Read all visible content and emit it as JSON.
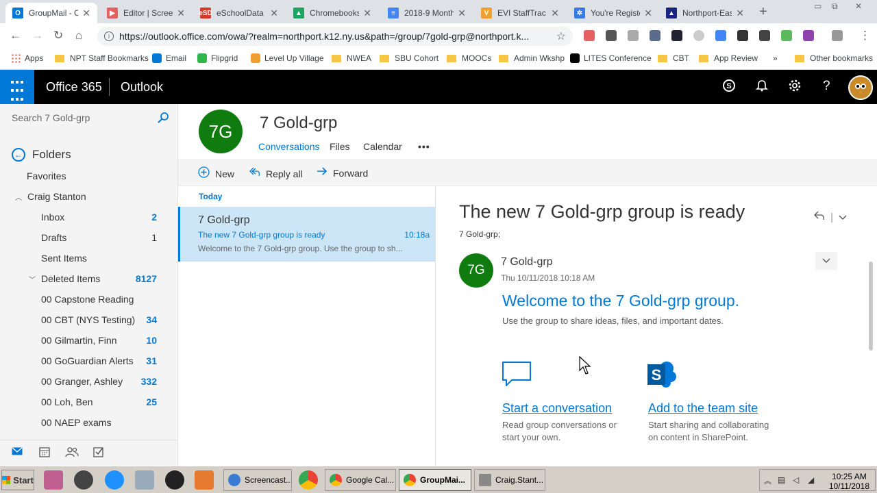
{
  "browser": {
    "tabs": [
      {
        "title": "GroupMail - Cr",
        "color": "#0078d7",
        "glyph": "O"
      },
      {
        "title": "Editor | Screen",
        "color": "#e56060",
        "glyph": "▶"
      },
      {
        "title": "eSchoolData -",
        "color": "#d83a2a",
        "glyph": "eSD"
      },
      {
        "title": "Chromebooks",
        "color": "#1fa463",
        "glyph": "▲"
      },
      {
        "title": "2018-9 Monthl",
        "color": "#4285f4",
        "glyph": "≡"
      },
      {
        "title": "EVI StaffTrac",
        "color": "#f0a030",
        "glyph": "V"
      },
      {
        "title": "You're Registe",
        "color": "#3b78e7",
        "glyph": "✲"
      },
      {
        "title": "Northport-East",
        "color": "#1a237e",
        "glyph": "▲"
      }
    ],
    "url": "https://outlook.office.com/owa/?realm=northport.k12.ny.us&path=/group/7gold-grp@northport.k...",
    "bookmarks": [
      {
        "label": "Apps",
        "type": "apps"
      },
      {
        "label": "NPT Staff Bookmarks",
        "type": "folder"
      },
      {
        "label": "Email",
        "type": "outlook"
      },
      {
        "label": "Flipgrid",
        "type": "flipgrid"
      },
      {
        "label": "Level Up Village",
        "type": "luv"
      },
      {
        "label": "NWEA",
        "type": "folder"
      },
      {
        "label": "SBU Cohort",
        "type": "folder"
      },
      {
        "label": "MOOCs",
        "type": "folder"
      },
      {
        "label": "Admin Wkshp",
        "type": "folder"
      },
      {
        "label": "LITES Conference",
        "type": "bb"
      },
      {
        "label": "CBT",
        "type": "folder"
      },
      {
        "label": "App Review",
        "type": "folder"
      },
      {
        "label": "»",
        "type": "more"
      },
      {
        "label": "Other bookmarks",
        "type": "folder"
      }
    ]
  },
  "o365": {
    "brand": "Office 365",
    "app": "Outlook"
  },
  "leftnav": {
    "search_placeholder": "Search 7 Gold-grp",
    "folders_label": "Folders",
    "favorites_label": "Favorites",
    "account": "Craig Stanton",
    "items": [
      {
        "label": "Inbox",
        "count": "2",
        "style": "blue"
      },
      {
        "label": "Drafts",
        "count": "1",
        "style": "grey"
      },
      {
        "label": "Sent Items",
        "count": "",
        "style": "blue"
      },
      {
        "label": "Deleted Items",
        "count": "8127",
        "style": "blue"
      },
      {
        "label": "00 Capstone Reading",
        "count": "",
        "style": "blue"
      },
      {
        "label": "00 CBT (NYS Testing)",
        "count": "34",
        "style": "blue"
      },
      {
        "label": "00 Gilmartin, Finn",
        "count": "10",
        "style": "blue"
      },
      {
        "label": "00 GoGuardian Alerts",
        "count": "31",
        "style": "blue"
      },
      {
        "label": "00 Granger, Ashley",
        "count": "332",
        "style": "blue"
      },
      {
        "label": "00 Loh, Ben",
        "count": "25",
        "style": "blue"
      },
      {
        "label": "00 NAEP exams",
        "count": "",
        "style": "blue"
      }
    ]
  },
  "group": {
    "initials": "7G",
    "name": "7 Gold-grp",
    "tabs": [
      "Conversations",
      "Files",
      "Calendar",
      "•••"
    ]
  },
  "commands": {
    "new": "New",
    "reply_all": "Reply all",
    "forward": "Forward"
  },
  "list": {
    "date_header": "Today",
    "message": {
      "from": "7 Gold-grp",
      "subject": "The new 7 Gold-grp group is ready",
      "time": "10:18a",
      "preview": "Welcome to the 7 Gold-grp group. Use the group to sh..."
    }
  },
  "reading": {
    "subject": "The new 7 Gold-grp group is ready",
    "to": "7 Gold-grp;",
    "sender_initials": "7G",
    "sender": "7 Gold-grp",
    "date": "Thu 10/11/2018 10:18 AM",
    "welcome": "Welcome to the 7 Gold-grp group.",
    "welcome_sub": "Use the group to share ideas, files, and important dates.",
    "action1": {
      "link": "Start a conversation",
      "desc": "Read group conversations or start your own."
    },
    "action2": {
      "link": "Add to the team site",
      "desc": "Start sharing and collaborating on content in SharePoint."
    }
  },
  "taskbar": {
    "start": "Start",
    "buttons": [
      {
        "label": "Screencast...",
        "color": "#3a7bd5"
      },
      {
        "label": "Google Cal...",
        "color": "#4285f4"
      },
      {
        "label": "GroupMai...",
        "color": "#4285f4"
      },
      {
        "label": "Craig.Stant...",
        "color": "#888888"
      }
    ],
    "time": "10:25 AM",
    "date": "10/11/2018"
  }
}
